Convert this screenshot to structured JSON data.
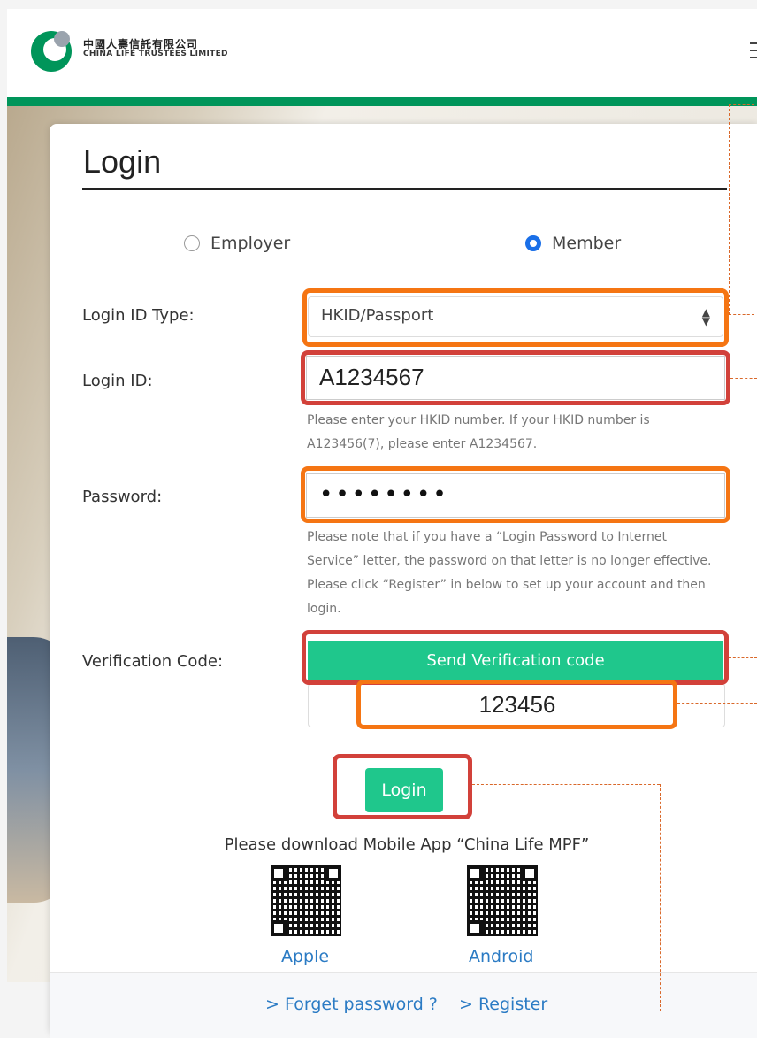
{
  "header": {
    "logo_cn": "中國人壽信託有限公司",
    "logo_en": "CHINA LIFE TRUSTEES LIMITED"
  },
  "login": {
    "title": "Login",
    "roles": [
      "Employer",
      "Member"
    ],
    "selected_role": "Member",
    "login_id_type_label": "Login ID Type:",
    "login_id_type_value": "HKID/Passport",
    "login_id_label": "Login ID:",
    "login_id_value": "A1234567",
    "login_id_hint": "Please enter your HKID number. If your HKID number is A123456(7), please enter A1234567.",
    "password_label": "Password:",
    "password_value": "••••••••",
    "password_hint": "Please note that if you have a “Login Password to Internet Service” letter, the password on that letter is no longer effective. Please click “Register” in below to set up your account and then login.",
    "verification_label": "Verification Code:",
    "send_code_label": "Send Verification code",
    "verification_value": "123456",
    "login_button": "Login"
  },
  "app": {
    "download_text": "Please download Mobile App “China Life MPF”",
    "apple_label": "Apple",
    "android_label": "Android"
  },
  "footer": {
    "forget_password": "> Forget password ?",
    "register": "> Register"
  },
  "colors": {
    "brand_green": "#00955a",
    "button_green": "#1fc78c",
    "highlight_orange": "#f57513",
    "highlight_red": "#d2413a",
    "link_blue": "#2b7bc4"
  }
}
